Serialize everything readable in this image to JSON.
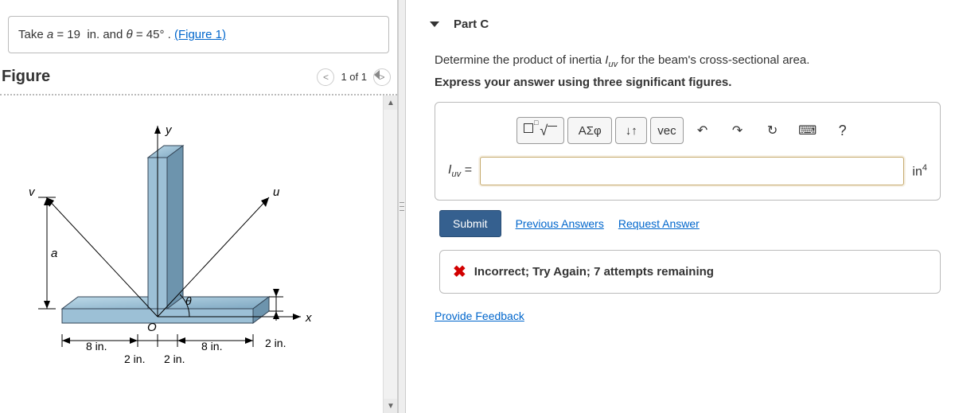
{
  "params": {
    "prefix": "Take ",
    "a_label": "a",
    "a_eq": " = 19  in. and ",
    "theta_label": "θ",
    "theta_eq": " = 45° . ",
    "figure_link": "(Figure 1)"
  },
  "figure": {
    "title": "Figure",
    "page": "1 of 1",
    "labels": {
      "y": "y",
      "v": "v",
      "u": "u",
      "a": "a",
      "x": "x",
      "O": "O",
      "theta": "θ",
      "d8l": "8 in.",
      "d8r": "8 in.",
      "d2a": "2 in.",
      "d2b": "2 in.",
      "d2c": "2 in."
    }
  },
  "part": {
    "title": "Part C",
    "question": "Determine the product of inertia ",
    "question_var": "I",
    "question_sub": "uv",
    "question_tail": " for the beam's cross-sectional area.",
    "instr": "Express your answer using three significant figures.",
    "toolbar": {
      "templates_sup": "□",
      "templates_root": "√",
      "greek": "ΑΣφ",
      "updown": "↓↑",
      "vec": "vec",
      "undo": "↶",
      "redo": "↷",
      "reset": "↻",
      "keyboard": "⌨",
      "help": "?"
    },
    "answer": {
      "lhs_var": "I",
      "lhs_sub": "uv",
      "eq": " =",
      "value": "",
      "unit_base": "in",
      "unit_exp": "4"
    },
    "actions": {
      "submit": "Submit",
      "previous": "Previous Answers",
      "request": "Request Answer"
    },
    "feedback": {
      "text": "Incorrect; Try Again; 7 attempts remaining"
    },
    "provide_feedback": "Provide Feedback"
  }
}
